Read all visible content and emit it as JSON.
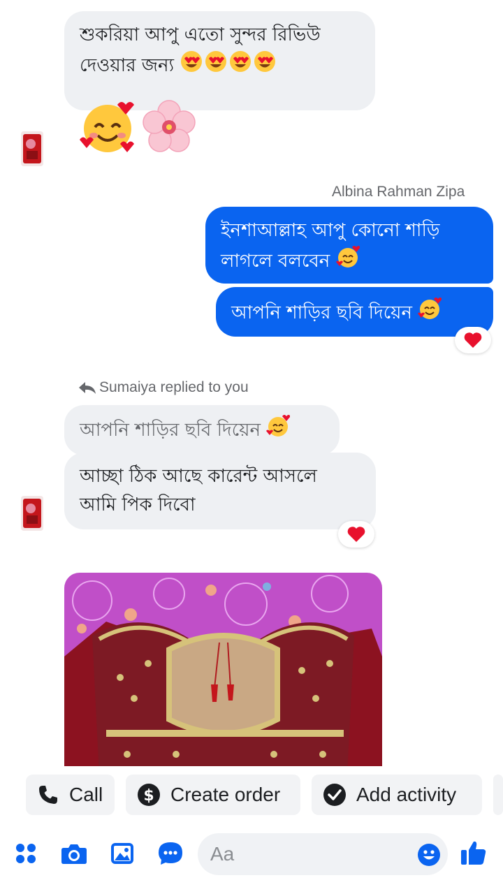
{
  "thread": {
    "msg1_line1": "শুকরিয়া আপু এতো সুন্দর রিভিউ",
    "msg1_line2": "দেওয়ার জন্য",
    "sender_name": "Albina Rahman Zipa",
    "out1_line1": "ইনশাআল্লাহ আপু কোনো শাড়ি",
    "out1_line2": "লাগলে বলবেন",
    "out2": "আপনি শাড়ির ছবি দিয়েন",
    "reply_note": "Sumaiya replied to you",
    "quoted": "আপনি শাড়ির ছবি দিয়েন",
    "reply_line1": "আচ্ছা ঠিক আছে কারেন্ট আসলে",
    "reply_line2": "আমি পিক দিবো"
  },
  "actions": {
    "call": "Call",
    "create_order": "Create order",
    "add_activity": "Add activity"
  },
  "composer": {
    "placeholder": "Aa"
  },
  "colors": {
    "accent": "#0a64f0",
    "incoming_bg": "#eef0f3",
    "reaction_heart": "#e8112d"
  }
}
